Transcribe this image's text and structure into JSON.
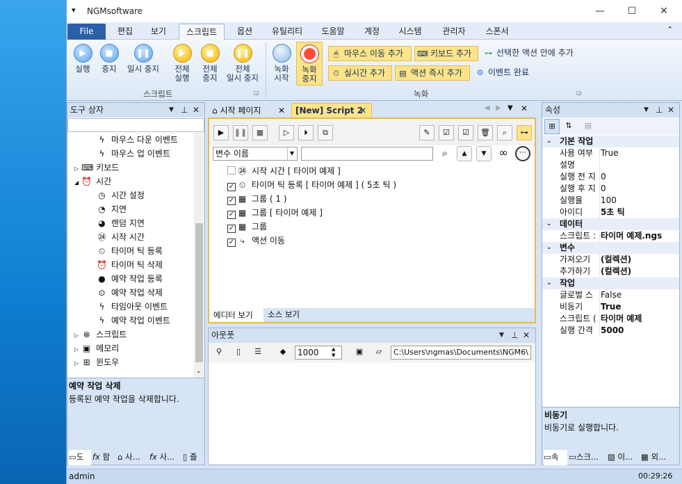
{
  "app": {
    "title": "NGMsoftware"
  },
  "menu": [
    "File",
    "편집",
    "보기",
    "스크립트",
    "옵션",
    "유틸리티",
    "도움말",
    "계정",
    "시스템",
    "관리자",
    "스폰서"
  ],
  "ribbon": {
    "script_group": "스크립트",
    "record_group": "녹화",
    "run": "실행",
    "stop": "중지",
    "pause": "일시 중지",
    "all_run": "전체\n실행",
    "all_stop": "전체\n중지",
    "all_pause": "전체\n일시 중지",
    "rec_start": "녹화\n시작",
    "rec_stop": "녹화\n중지",
    "mouse_move": "마우스 이동 추가",
    "keyboard": "키보드 추가",
    "add_in_selected": "선택한 액션 안에 추가",
    "realtime": "실시간 추가",
    "action_now": "액션 즉시 추가",
    "event_done": "이벤트 완료"
  },
  "toolbox": {
    "title": "도구 상자",
    "items": [
      "마우스 다운 이벤트",
      "마우스 업 이벤트",
      "키보드",
      "시간",
      "시간 설정",
      "지연",
      "랜덤 지연",
      "시작 시간",
      "타이머 틱 등록",
      "타이머 틱 삭제",
      "예약 작업 등록",
      "예약 작업 삭제",
      "타임아웃 이벤트",
      "예약 작업 이벤트",
      "스크립트",
      "메모리",
      "윈도우"
    ],
    "desc_title": "예약 작업 삭제",
    "desc_text": "등록된 예약 작업을 삭제합니다.",
    "tabs": [
      "도",
      "함",
      "사...",
      "사...",
      "즐"
    ]
  },
  "editor": {
    "tabs": [
      "시작 페이지",
      "[New] Script 2"
    ],
    "var_select": "변수 이름",
    "actions": [
      {
        "checked": false,
        "text": "시작 시간 [ 타이머 예제 ]"
      },
      {
        "checked": true,
        "text": "타이머 틱 등록 [ 타이머 예제 ] ( 5초 틱 )"
      },
      {
        "checked": true,
        "text": "그룹 ( 1 )"
      },
      {
        "checked": true,
        "text": "그룹 [ 타이머 예제 ]"
      },
      {
        "checked": true,
        "text": "그룹"
      },
      {
        "checked": true,
        "text": "액션 이동"
      }
    ],
    "view_tabs": [
      "에디터 보기",
      "소스 보기"
    ]
  },
  "output": {
    "title": "아웃풋",
    "count": "1000",
    "path": "C:\\Users\\ngmas\\Documents\\NGM6\\"
  },
  "props": {
    "title": "속성",
    "rows": [
      {
        "cat": true,
        "k": "기본 작업"
      },
      {
        "k": "사용 여부",
        "v": "True"
      },
      {
        "k": "설명",
        "v": ""
      },
      {
        "k": "실행 전 지",
        "v": "0"
      },
      {
        "k": "실행 후 지",
        "v": "0"
      },
      {
        "k": "실행율",
        "v": "100"
      },
      {
        "k": "아이디",
        "v": "5초 틱",
        "b": true
      },
      {
        "cat": true,
        "k": "데이터"
      },
      {
        "k": "스크립트 :",
        "v": "타이머 예제.ngs",
        "b": true
      },
      {
        "cat": true,
        "k": "변수"
      },
      {
        "k": "가져오기",
        "v": "(컬렉션)",
        "b": true
      },
      {
        "k": "추가하기",
        "v": "(컬렉션)",
        "b": true
      },
      {
        "cat": true,
        "k": "작업"
      },
      {
        "k": "글로벌 스",
        "v": "False"
      },
      {
        "k": "비동기",
        "v": "True",
        "b": true
      },
      {
        "k": "스크립트 (",
        "v": "타이머 예제",
        "b": true
      },
      {
        "k": "실행 간격",
        "v": "5000",
        "b": true
      }
    ],
    "desc_title": "비동기",
    "desc_text": "비동기로 실행합니다.",
    "tabs": [
      "속",
      "스크...",
      "이...",
      "외..."
    ]
  },
  "status": {
    "user": "admin",
    "time": "00:29:26"
  }
}
